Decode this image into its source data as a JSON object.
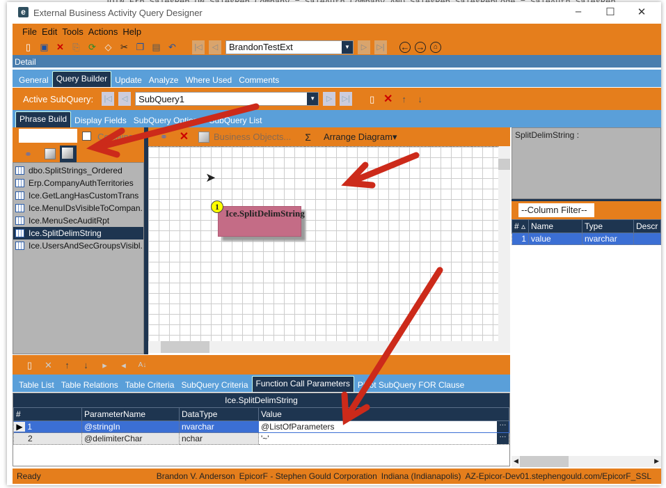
{
  "background_code": "JOIN Erp.SalesRep ON SalesRep.Company = SaleAuth.Company AND SalesRep.SalesRepCode = SaleAuth.SalesRep",
  "window": {
    "title": "External Business Activity Query Designer",
    "minimize": "–",
    "maximize": "☐",
    "close": "✕",
    "logo": "e"
  },
  "menu": [
    "File",
    "Edit",
    "Tools",
    "Actions",
    "Help"
  ],
  "toolbar": {
    "record": "BrandonTestExt"
  },
  "detail_label": "Detail",
  "main_tabs": [
    "General",
    "Query Builder",
    "Update",
    "Analyze",
    "Where Used",
    "Comments"
  ],
  "active_subquery": {
    "label": "Active SubQuery:",
    "value": "SubQuery1"
  },
  "sub_tabs": [
    "Phrase Build",
    "Display Fields",
    "SubQuery Options",
    "SubQuery List"
  ],
  "left_panel": {
    "search_value": "",
    "contains_label": "Contains",
    "items": [
      "dbo.SplitStrings_Ordered",
      "Erp.CompanyAuthTerritories",
      "Ice.GetLangHasCustomTrans",
      "Ice.MenuIDsVisibleToCompan...",
      "Ice.MenuSecAuditRpt",
      "Ice.SplitDelimString",
      "Ice.UsersAndSecGroupsVisibl..."
    ],
    "selected": 5
  },
  "canvas_toolbar": {
    "business_objects": "Business Objects...",
    "sigma": "Σ",
    "arrange": "Arrange Diagram"
  },
  "diagram": {
    "node_number": "1",
    "node_label": "Ice.SplitDelimString"
  },
  "right_panel": {
    "header": "SplitDelimString :",
    "column_filter": "--Column Filter--",
    "columns": [
      "#",
      "Name",
      "Type",
      "Descr"
    ],
    "rows": [
      {
        "num": "1",
        "name": "value",
        "type": "nvarchar",
        "desc": ""
      }
    ]
  },
  "bottom_tabs": [
    "Table List",
    "Table Relations",
    "Table Criteria",
    "SubQuery Criteria",
    "Function Call Parameters",
    "Pivot SubQuery FOR Clause"
  ],
  "params_grid": {
    "title": "Ice.SplitDelimString",
    "columns": [
      "#",
      "ParameterName",
      "DataType",
      "Value"
    ],
    "rows": [
      {
        "num": "1",
        "name": "@stringIn",
        "type": "nvarchar",
        "value": "@ListOfParameters"
      },
      {
        "num": "2",
        "name": "@delimiterChar",
        "type": "nchar",
        "value": "'~'"
      }
    ],
    "ellipsis": "···"
  },
  "status": {
    "state": "Ready",
    "user": "Brandon V. Anderson",
    "company": "EpicorF - Stephen Gould Corporation",
    "site": "Indiana (Indianapolis)",
    "server": "AZ-Epicor-Dev01.stephengould.com/EpicorF_SSL"
  },
  "colors": {
    "orange": "#e57e1c",
    "blue": "#5a9fd9",
    "navy": "#1e3550",
    "arrow": "#cc2a1a",
    "node": "#c46c86"
  }
}
